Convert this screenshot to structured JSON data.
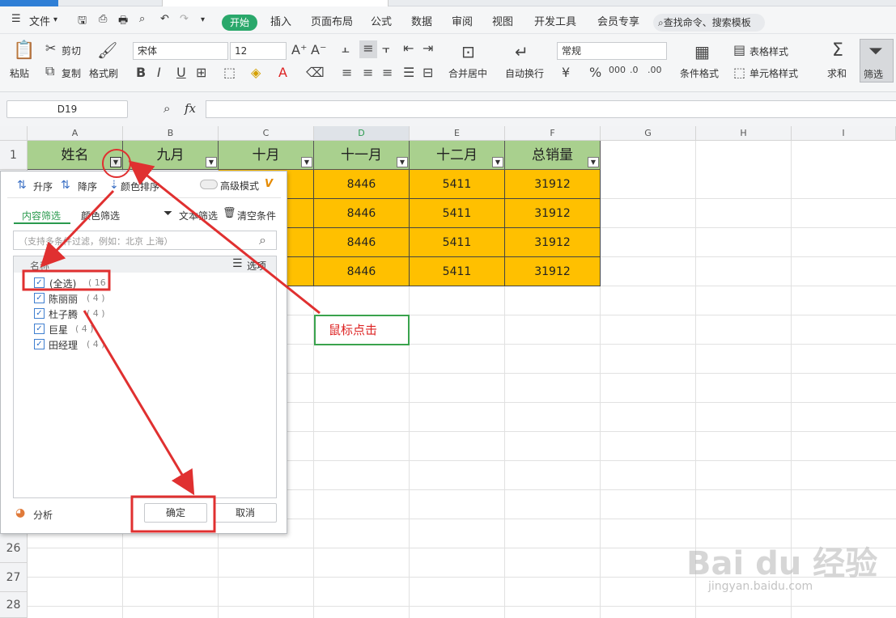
{
  "top_menu": {
    "file": "文件",
    "start": "开始",
    "items": [
      "插入",
      "页面布局",
      "公式",
      "数据",
      "审阅",
      "视图",
      "开发工具",
      "会员专享"
    ],
    "search": "查找命令、搜索模板"
  },
  "ribbon": {
    "paste": "粘贴",
    "cut": "剪切",
    "copy": "复制",
    "format_painter": "格式刷",
    "font_name": "宋体",
    "font_size": "12",
    "merge_center": "合并居中",
    "auto_wrap": "自动换行",
    "number_format": "常规",
    "conditional_format": "条件格式",
    "table_style": "表格样式",
    "cell_style": "单元格样式",
    "sum": "求和",
    "filter": "筛选"
  },
  "formula_bar": {
    "name_box": "D19",
    "fx": "fx",
    "value": ""
  },
  "columns": [
    "A",
    "B",
    "C",
    "D",
    "E",
    "F",
    "G",
    "H",
    "I"
  ],
  "header_row": [
    "姓名",
    "九月",
    "十月",
    "十一月",
    "十二月",
    "总销量"
  ],
  "data_rows": [
    [
      "8446",
      "5411",
      "31912"
    ],
    [
      "8446",
      "5411",
      "31912"
    ],
    [
      "8446",
      "5411",
      "31912"
    ],
    [
      "8446",
      "5411",
      "31912"
    ]
  ],
  "row_numbers": {
    "first": "1",
    "r26": "26",
    "r27": "27",
    "r28": "28"
  },
  "filter_panel": {
    "sort_asc": "升序",
    "sort_desc": "降序",
    "color_sort": "颜色排序",
    "advanced_mode": "高级模式",
    "tab_content": "内容筛选",
    "tab_color": "颜色筛选",
    "text_filter": "文本筛选",
    "clear_conditions": "清空条件",
    "search_placeholder": "（支持多条件过滤，例如：北京  上海）",
    "list_header": "名称",
    "options": "选项",
    "items": [
      {
        "label": "(全选)",
        "count": "( 16"
      },
      {
        "label": "陈丽丽",
        "count": "( 4 )"
      },
      {
        "label": "杜子腾",
        "count": "( 4 )"
      },
      {
        "label": "巨星",
        "count": "( 4 )"
      },
      {
        "label": "田经理",
        "count": "( 4 )"
      }
    ],
    "analysis": "分析",
    "ok": "确定",
    "cancel": "取消"
  },
  "annotation": {
    "callout": "鼠标点击",
    "color": "#e03030"
  },
  "watermark": {
    "main": "Bai du 经验",
    "sub": "jingyan.baidu.com"
  }
}
